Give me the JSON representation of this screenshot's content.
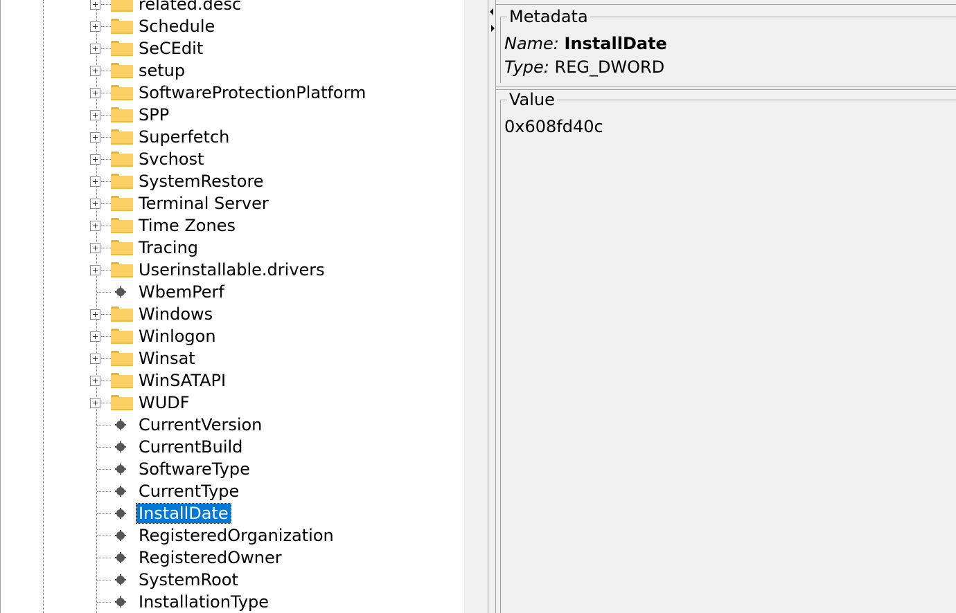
{
  "tree": {
    "rows": [
      {
        "label": "related.desc",
        "kind": "folder"
      },
      {
        "label": "Schedule",
        "kind": "folder"
      },
      {
        "label": "SeCEdit",
        "kind": "folder"
      },
      {
        "label": "setup",
        "kind": "folder"
      },
      {
        "label": "SoftwareProtectionPlatform",
        "kind": "folder"
      },
      {
        "label": "SPP",
        "kind": "folder"
      },
      {
        "label": "Superfetch",
        "kind": "folder"
      },
      {
        "label": "Svchost",
        "kind": "folder"
      },
      {
        "label": "SystemRestore",
        "kind": "folder"
      },
      {
        "label": "Terminal Server",
        "kind": "folder"
      },
      {
        "label": "Time Zones",
        "kind": "folder"
      },
      {
        "label": "Tracing",
        "kind": "folder"
      },
      {
        "label": "Userinstallable.drivers",
        "kind": "folder"
      },
      {
        "label": "WbemPerf",
        "kind": "value"
      },
      {
        "label": "Windows",
        "kind": "folder"
      },
      {
        "label": "Winlogon",
        "kind": "folder"
      },
      {
        "label": "Winsat",
        "kind": "folder"
      },
      {
        "label": "WinSATAPI",
        "kind": "folder"
      },
      {
        "label": "WUDF",
        "kind": "folder"
      },
      {
        "label": "CurrentVersion",
        "kind": "value"
      },
      {
        "label": "CurrentBuild",
        "kind": "value"
      },
      {
        "label": "SoftwareType",
        "kind": "value"
      },
      {
        "label": "CurrentType",
        "kind": "value"
      },
      {
        "label": "InstallDate",
        "kind": "value",
        "selected": true
      },
      {
        "label": "RegisteredOrganization",
        "kind": "value"
      },
      {
        "label": "RegisteredOwner",
        "kind": "value"
      },
      {
        "label": "SystemRoot",
        "kind": "value"
      },
      {
        "label": "InstallationType",
        "kind": "value"
      }
    ]
  },
  "metadata": {
    "title": "Metadata",
    "name_key": "Name:",
    "name_value": "InstallDate",
    "type_key": "Type:",
    "type_value": "REG_DWORD"
  },
  "value": {
    "title": "Value",
    "content": "0x608fd40c"
  },
  "colors": {
    "selection": "#0078d7",
    "folder": "#fcd064"
  }
}
